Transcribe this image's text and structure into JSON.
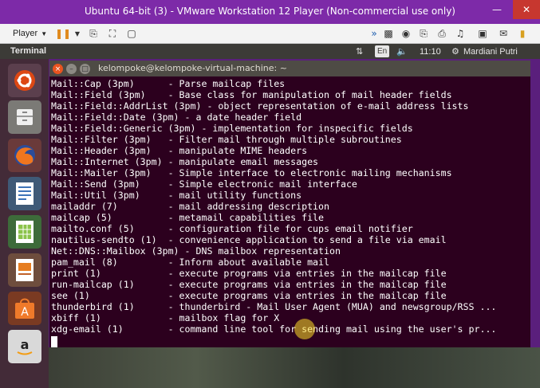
{
  "vmware": {
    "title": "Ubuntu 64-bit (3) - VMware Workstation 12 Player (Non-commercial use only)",
    "player_menu": "Player",
    "toolbar_icons": [
      "pause-icon",
      "dropdown-icon",
      "send-ctrl-alt-del-icon",
      "fullscreen-icon",
      "unity-icon",
      "forward-icon",
      "network-icon",
      "cd-icon",
      "usb-icon",
      "printer-icon",
      "sound-icon",
      "display-icon",
      "message-icon"
    ]
  },
  "panel": {
    "app_name": "Terminal",
    "keyboard": "En",
    "time": "11:10",
    "user": "Mardiani Putri"
  },
  "launcher": {
    "items": [
      "ubuntu-dash-icon",
      "files-icon",
      "firefox-icon",
      "libreoffice-writer-icon",
      "libreoffice-calc-icon",
      "libreoffice-impress-icon",
      "software-center-icon",
      "amazon-icon"
    ]
  },
  "terminal": {
    "title": "kelompoke@kelompoke-virtual-machine: ~",
    "lines": [
      "Mail::Cap (3pm)      - Parse mailcap files",
      "Mail::Field (3pm)    - Base class for manipulation of mail header fields",
      "Mail::Field::AddrList (3pm) - object representation of e-mail address lists",
      "Mail::Field::Date (3pm) - a date header field",
      "Mail::Field::Generic (3pm) - implementation for inspecific fields",
      "Mail::Filter (3pm)   - Filter mail through multiple subroutines",
      "Mail::Header (3pm)   - manipulate MIME headers",
      "Mail::Internet (3pm) - manipulate email messages",
      "Mail::Mailer (3pm)   - Simple interface to electronic mailing mechanisms",
      "Mail::Send (3pm)     - Simple electronic mail interface",
      "Mail::Util (3pm)     - mail utility functions",
      "mailaddr (7)         - mail addressing description",
      "mailcap (5)          - metamail capabilities file",
      "mailto.conf (5)      - configuration file for cups email notifier",
      "nautilus-sendto (1)  - convenience application to send a file via email",
      "Net::DNS::Mailbox (3pm) - DNS mailbox representation",
      "pam_mail (8)         - Inform about available mail",
      "print (1)            - execute programs via entries in the mailcap file",
      "run-mailcap (1)      - execute programs via entries in the mailcap file",
      "see (1)              - execute programs via entries in the mailcap file",
      "thunderbird (1)      - thunderbird - Mail User Agent (MUA) and newsgroup/RSS ...",
      "xbiff (1)            - mailbox flag for X",
      "xdg-email (1)        - command line tool for sending mail using the user's pr..."
    ]
  }
}
